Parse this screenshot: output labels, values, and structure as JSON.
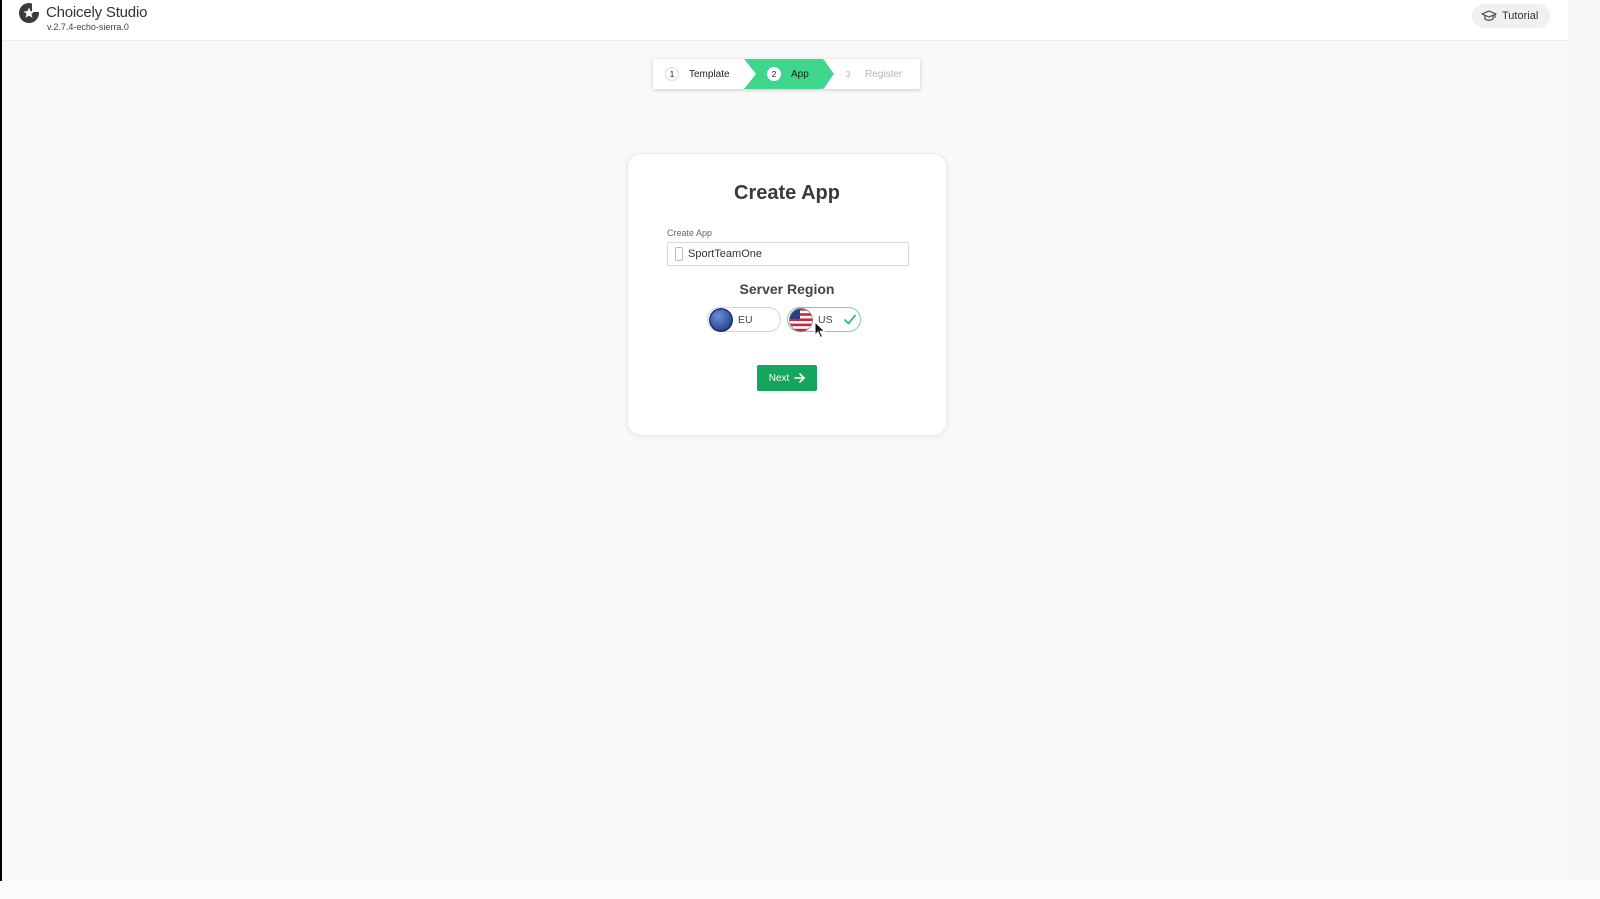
{
  "header": {
    "brand_name": "Choicely Studio",
    "version": "v.2.7.4-echo-sierra.0",
    "tutorial_label": "Tutorial"
  },
  "stepper": {
    "steps": [
      {
        "number": "1",
        "label": "Template",
        "state": "done"
      },
      {
        "number": "2",
        "label": "App",
        "state": "active"
      },
      {
        "number": "3",
        "label": "Register",
        "state": "upcoming"
      }
    ],
    "active_color": "#3dd68c"
  },
  "card": {
    "title": "Create App",
    "field_label": "Create App",
    "app_name_value": "SportTeamOne",
    "region_title": "Server Region",
    "regions": [
      {
        "label": "EU",
        "selected": false
      },
      {
        "label": "US",
        "selected": true
      }
    ],
    "next_label": "Next"
  },
  "colors": {
    "accent_green": "#16a55c",
    "selected_border": "#7fcea0"
  }
}
